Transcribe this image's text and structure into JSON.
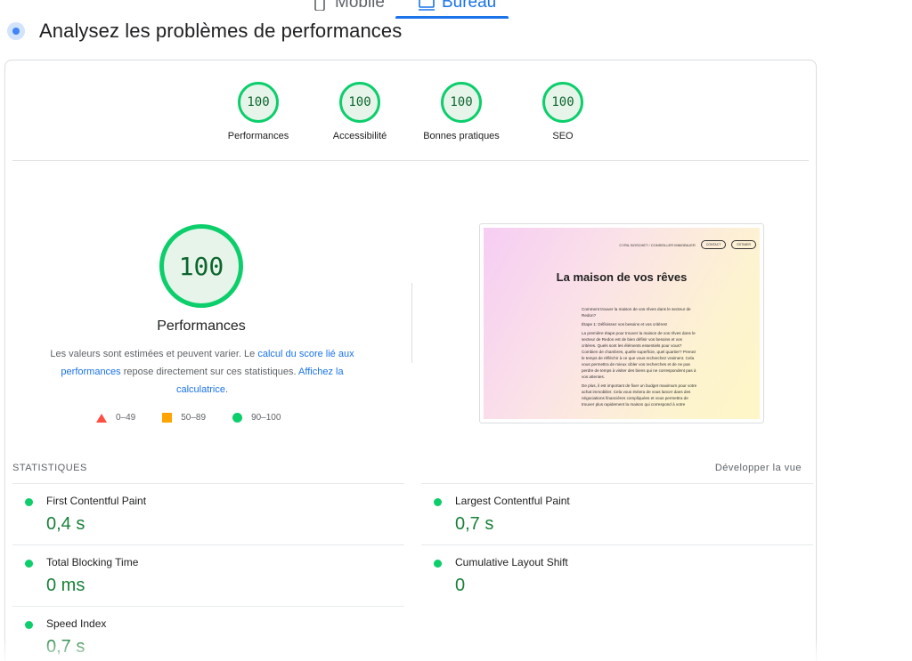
{
  "device_tabs": {
    "mobile": {
      "label": "Mobile",
      "icon": "mobile-icon"
    },
    "desktop": {
      "label": "Bureau",
      "icon": "desktop-icon",
      "active": true
    }
  },
  "header": {
    "icon": "lighthouse-dot-icon",
    "title": "Analysez les problèmes de performances"
  },
  "categories": [
    {
      "score": "100",
      "label": "Performances"
    },
    {
      "score": "100",
      "label": "Accessibilité"
    },
    {
      "score": "100",
      "label": "Bonnes pratiques"
    },
    {
      "score": "100",
      "label": "SEO"
    }
  ],
  "main_gauge": {
    "score": "100",
    "label": "Performances"
  },
  "explanation": {
    "part1": "Les valeurs sont estimées et peuvent varier. Le ",
    "link1": "calcul du score lié aux performances",
    "part2": " repose directement sur ces statistiques. ",
    "link2": "Affichez la calculatrice",
    "part3": "."
  },
  "legend": [
    {
      "shape": "triangle",
      "range": "0–49",
      "color": "#ff4e42"
    },
    {
      "shape": "square",
      "range": "50–89",
      "color": "#ffa400"
    },
    {
      "shape": "circle",
      "range": "90–100",
      "color": "#0cce6b"
    }
  ],
  "thumbnail": {
    "nav_brand": "CYRIL BOSCHET / CONSEILLER IMMOBILIER",
    "nav_btn1": "CONTACT",
    "nav_btn2": "ESTIMER",
    "title": "La maison de vos rêves",
    "intro": "Comment trouver la maison de vos rêves dans le secteur de Redon?",
    "step": "Étape 1: Définissez vos besoins et vos critères!",
    "para1": "La première étape pour trouver la maison de vos rêves dans le secteur de Redon est de bien définir vos besoins et vos critères. Quels sont les éléments essentiels pour vous? Combien de chambres, quelle superficie, quel quartier? Prenez le temps de réfléchir à ce que vous recherchez vraiment. Cela vous permettra de mieux cibler vos recherches et de ne pas perdre de temps à visiter des biens qui ne correspondent pas à vos attentes.",
    "para2": "De plus, il est important de fixer un budget maximum pour votre achat immobilier. Cela vous évitera de vous lancer dans des négociations financières compliquées et vous permettra de trouver plus rapidement la maison qui correspond à votre"
  },
  "stats": {
    "heading": "STATISTIQUES",
    "expand": "Développer la vue",
    "metrics": [
      {
        "name": "First Contentful Paint",
        "value": "0,4 s"
      },
      {
        "name": "Largest Contentful Paint",
        "value": "0,7 s"
      },
      {
        "name": "Total Blocking Time",
        "value": "0 ms"
      },
      {
        "name": "Cumulative Layout Shift",
        "value": "0"
      },
      {
        "name": "Speed Index",
        "value": "0,7 s"
      }
    ]
  },
  "colors": {
    "pass": "#0cce6b",
    "pass_text": "#188038",
    "link": "#1a73e8"
  }
}
